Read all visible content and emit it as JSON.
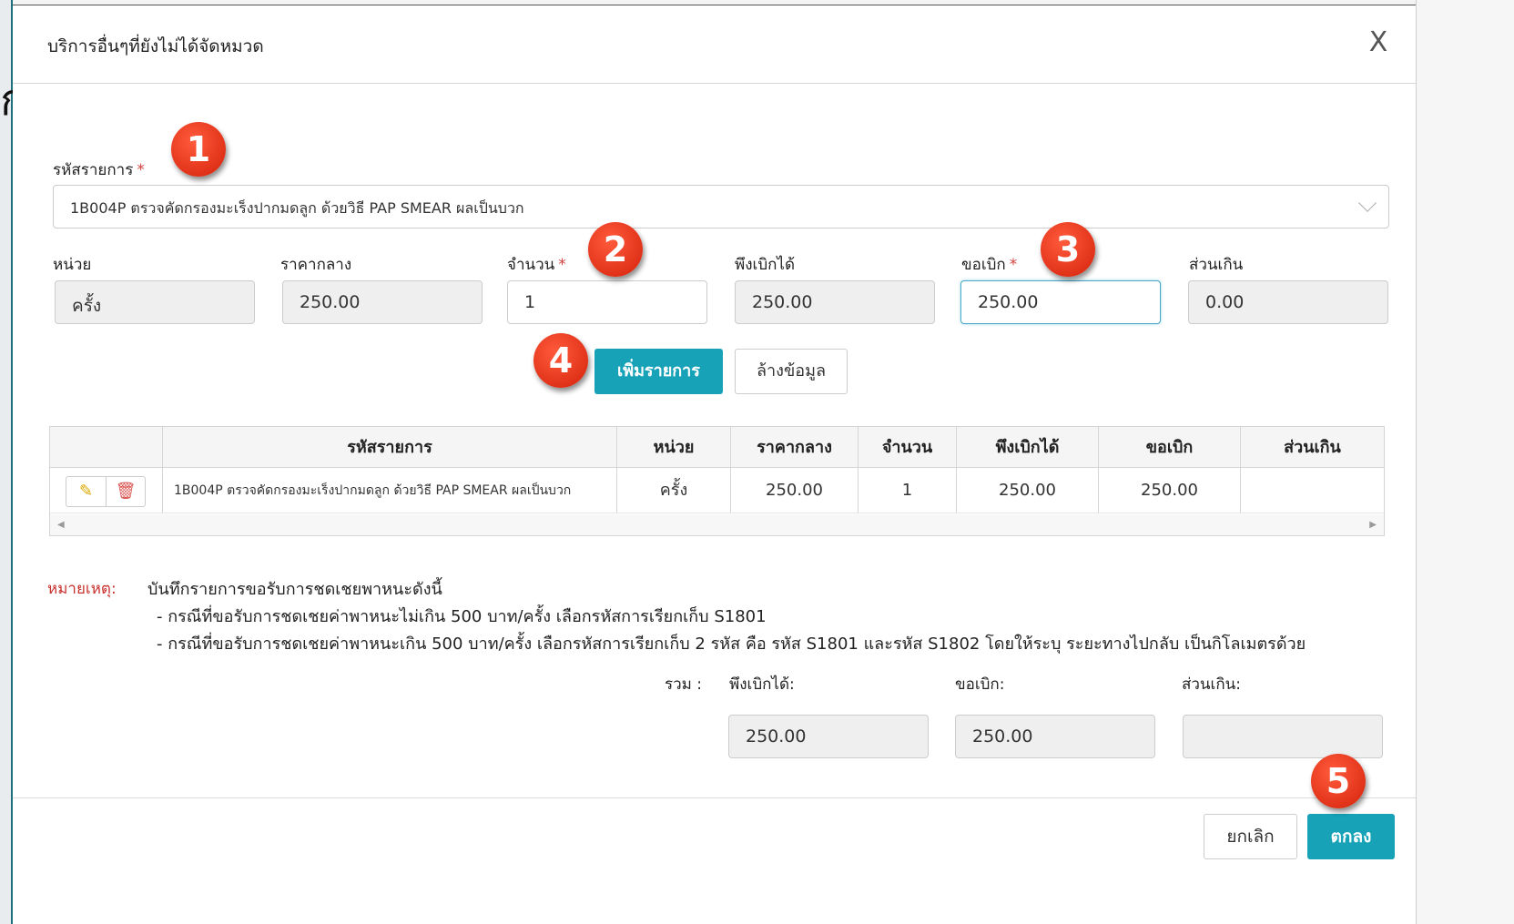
{
  "dialog": {
    "title": "บริการอื่นๆที่ยังไม่ได้จัดหมวด",
    "close_glyph": "X",
    "bg_glyph": "ก"
  },
  "form": {
    "item_code_label": "รหัสรายการ",
    "required_mark": "*",
    "item_code_value": "1B004P ตรวจคัดกรองมะเร็งปากมดลูก ด้วยวิธี PAP SMEAR ผลเป็นบวก",
    "fields": {
      "unit": {
        "label": "หน่วย",
        "value": "ครั้ง"
      },
      "median_price": {
        "label": "ราคากลาง",
        "value": "250.00"
      },
      "quantity": {
        "label": "จำนวน",
        "value": "1"
      },
      "eligible": {
        "label": "พึงเบิกได้",
        "value": "250.00"
      },
      "claim": {
        "label": "ขอเบิก",
        "value": "250.00"
      },
      "excess": {
        "label": "ส่วนเกิน",
        "value": "0.00"
      }
    },
    "add_button": "เพิ่มรายการ",
    "clear_button": "ล้างข้อมูล"
  },
  "table": {
    "headers": [
      "รหัสรายการ",
      "หน่วย",
      "ราคากลาง",
      "จำนวน",
      "พึงเบิกได้",
      "ขอเบิก",
      "ส่วนเกิน"
    ],
    "rows": [
      {
        "code": "1B004P ตรวจคัดกรองมะเร็งปากมดลูก ด้วยวิธี PAP SMEAR ผลเป็นบวก",
        "unit": "ครั้ง",
        "median_price": "250.00",
        "quantity": "1",
        "eligible": "250.00",
        "claim": "250.00",
        "excess": ""
      }
    ]
  },
  "note": {
    "label": "หมายเหตุ:",
    "line1": "บันทึกรายการขอรับการชดเชยพาหนะดังนี้",
    "line2": "- กรณีที่ขอรับการชดเชยค่าพาหนะไม่เกิน 500 บาท/ครั้ง เลือกรหัสการเรียกเก็บ S1801",
    "line3": "- กรณีที่ขอรับการชดเชยค่าพาหนะเกิน 500 บาท/ครั้ง เลือกรหัสการเรียกเก็บ 2 รหัส คือ รหัส S1801 และรหัส S1802 โดยให้ระบุ ระยะทางไปกลับ เป็นกิโลเมตรด้วย"
  },
  "totals": {
    "label": "รวม :",
    "eligible_label": "พึงเบิกได้:",
    "claim_label": "ขอเบิก:",
    "excess_label": "ส่วนเกิน:",
    "eligible_value": "250.00",
    "claim_value": "250.00",
    "excess_value": ""
  },
  "footer": {
    "cancel": "ยกเลิก",
    "ok": "ตกลง"
  },
  "badges": [
    "1",
    "2",
    "3",
    "4",
    "5"
  ],
  "colors": {
    "primary": "#17a2b8",
    "badge": "#e8330f",
    "required": "#d43f3a"
  },
  "icons": {
    "edit": "pencil-icon",
    "delete": "trash-icon",
    "close": "close-icon",
    "dropdown": "chevron-down-icon"
  }
}
